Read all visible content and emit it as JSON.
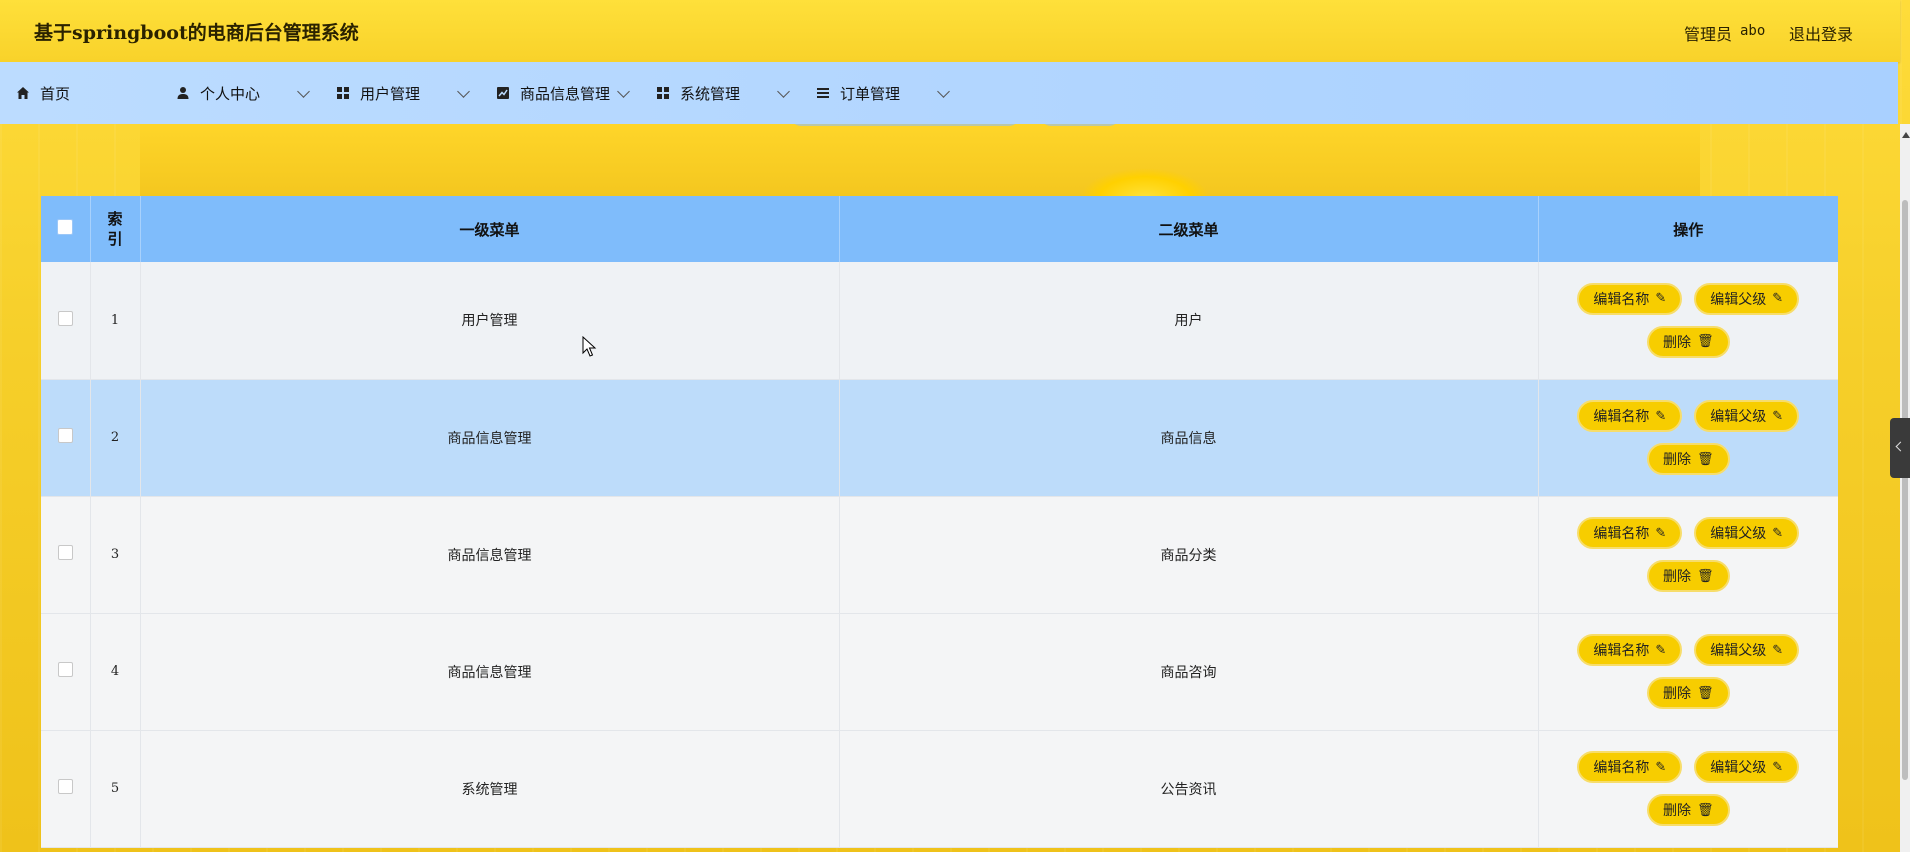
{
  "header": {
    "title": "基于springboot的电商后台管理系统",
    "role": "管理员",
    "username": "abo",
    "logout": "退出登录"
  },
  "nav": {
    "home": "首页",
    "profile": "个人中心",
    "users": "用户管理",
    "products": "商品信息管理",
    "system": "系统管理",
    "orders": "订单管理"
  },
  "table": {
    "headers": {
      "index": "索引",
      "first_menu": "一级菜单",
      "second_menu": "二级菜单",
      "actions": "操作"
    },
    "rows": [
      {
        "index": "1",
        "first": "用户管理",
        "second": "用户"
      },
      {
        "index": "2",
        "first": "商品信息管理",
        "second": "商品信息"
      },
      {
        "index": "3",
        "first": "商品信息管理",
        "second": "商品分类"
      },
      {
        "index": "4",
        "first": "商品信息管理",
        "second": "商品咨询"
      },
      {
        "index": "5",
        "first": "系统管理",
        "second": "公告资讯"
      }
    ],
    "actions": {
      "edit_name": "编辑名称",
      "edit_parent": "编辑父级",
      "delete": "删除"
    }
  },
  "colors": {
    "topbar": "#f8d22a",
    "navbar": "#a9d0ff",
    "header_row": "#7fbcfb",
    "highlight_row": "#bddcfa",
    "button": "#f7cd00"
  }
}
